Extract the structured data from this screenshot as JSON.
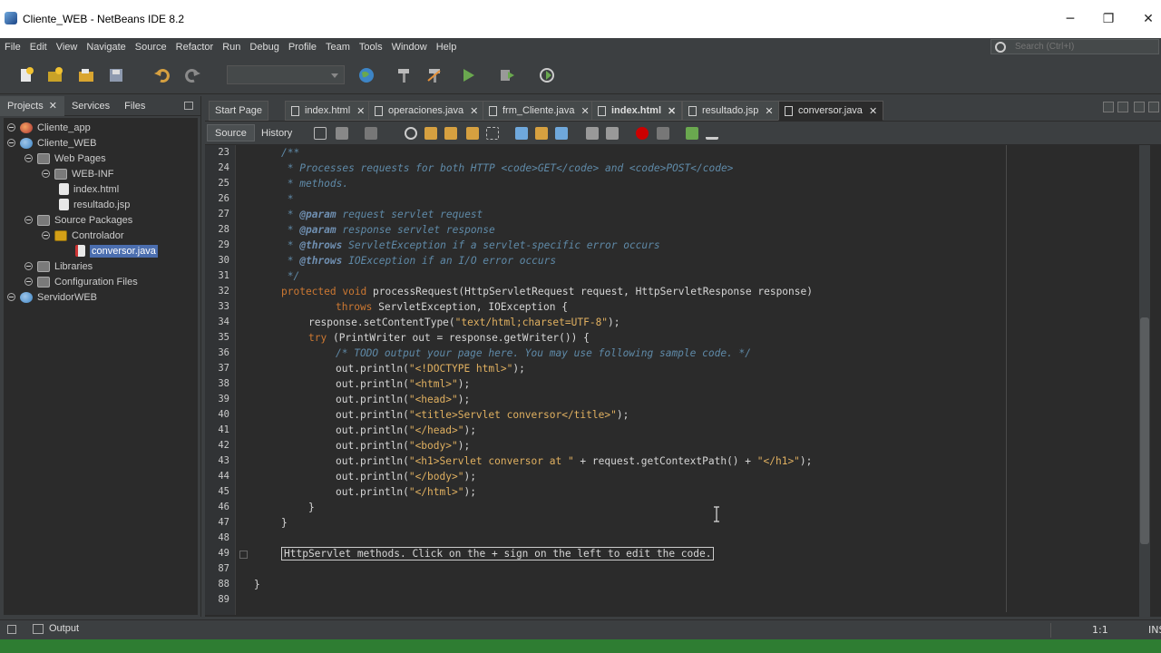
{
  "window": {
    "title": "Cliente_WEB - NetBeans IDE 8.2",
    "min": "─",
    "restore": "❐",
    "close": "✕"
  },
  "menu": [
    "File",
    "Edit",
    "View",
    "Navigate",
    "Source",
    "Refactor",
    "Run",
    "Debug",
    "Profile",
    "Team",
    "Tools",
    "Window",
    "Help"
  ],
  "search": {
    "placeholder": "Search (Ctrl+I)"
  },
  "panel_tabs": {
    "projects": "Projects",
    "services": "Services",
    "files": "Files",
    "close": "✕"
  },
  "tree": [
    {
      "label": "Cliente_app",
      "icon": "project-icon"
    },
    {
      "label": "Cliente_WEB",
      "icon": "web-project-icon"
    },
    {
      "label": "Web Pages",
      "icon": "folder-icon"
    },
    {
      "label": "WEB-INF",
      "icon": "folder-icon"
    },
    {
      "label": "index.html",
      "icon": "html-file-icon"
    },
    {
      "label": "resultado.jsp",
      "icon": "jsp-file-icon"
    },
    {
      "label": "Source Packages",
      "icon": "folder-icon"
    },
    {
      "label": "Controlador",
      "icon": "package-icon"
    },
    {
      "label": "conversor.java",
      "icon": "java-file-icon"
    },
    {
      "label": "Libraries",
      "icon": "folder-icon"
    },
    {
      "label": "Configuration Files",
      "icon": "folder-icon"
    },
    {
      "label": "ServidorWEB",
      "icon": "web-project-icon"
    }
  ],
  "editor_tabs": [
    {
      "label": "Start Page"
    },
    {
      "label": "index.html"
    },
    {
      "label": "operaciones.java"
    },
    {
      "label": "frm_Cliente.java"
    },
    {
      "label": "index.html"
    },
    {
      "label": "resultado.jsp"
    },
    {
      "label": "conversor.java"
    }
  ],
  "tab_close": "✕",
  "editor_toolbar": {
    "source": "Source",
    "history": "History"
  },
  "line_numbers": [
    "23",
    "24",
    "25",
    "26",
    "27",
    "28",
    "29",
    "30",
    "31",
    "32",
    "33",
    "34",
    "35",
    "36",
    "37",
    "38",
    "39",
    "40",
    "41",
    "42",
    "43",
    "44",
    "45",
    "46",
    "47",
    "48",
    "49",
    "87",
    "88",
    "89"
  ],
  "code": {
    "l23": "/**",
    "l24": " * Processes requests for both HTTP <code>GET</code> and <code>POST</code>",
    "l25": " * methods.",
    "l26": " *",
    "l27a": " * ",
    "l27b": "@param",
    "l27c": " request servlet request",
    "l28a": " * ",
    "l28b": "@param",
    "l28c": " response servlet response",
    "l29a": " * ",
    "l29b": "@throws",
    "l29c": " ServletException if a servlet-specific error occurs",
    "l30a": " * ",
    "l30b": "@throws",
    "l30c": " IOException if an I/O error occurs",
    "l31": " */",
    "l32a": "protected void",
    "l32b": " processRequest(HttpServletRequest request, HttpServletResponse response)",
    "l33a": "throws",
    "l33b": " ServletException, IOException {",
    "l34a": "response.setContentType(",
    "l34b": "\"text/html;charset=UTF-8\"",
    "l34c": ");",
    "l35a": "try",
    "l35b": " (PrintWriter out = response.getWriter()) {",
    "l36": "/* TODO output your page here. You may use following sample code. */",
    "l37a": "out.println(",
    "l37b": "\"<!DOCTYPE html>\"",
    "l37c": ");",
    "l38a": "out.println(",
    "l38b": "\"<html>\"",
    "l38c": ");",
    "l39a": "out.println(",
    "l39b": "\"<head>\"",
    "l39c": ");",
    "l40a": "out.println(",
    "l40b": "\"<title>Servlet conversor</title>\"",
    "l40c": ");",
    "l41a": "out.println(",
    "l41b": "\"</head>\"",
    "l41c": ");",
    "l42a": "out.println(",
    "l42b": "\"<body>\"",
    "l42c": ");",
    "l43a": "out.println(",
    "l43b": "\"<h1>Servlet conversor at \"",
    "l43c": " + request.getContextPath() + ",
    "l43d": "\"</h1>\"",
    "l43e": ");",
    "l44a": "out.println(",
    "l44b": "\"</body>\"",
    "l44c": ");",
    "l45a": "out.println(",
    "l45b": "\"</html>\"",
    "l45c": ");",
    "l46": "}",
    "l47": "}",
    "l49": "HttpServlet methods. Click on the + sign on the left to edit the code.",
    "l88": "}"
  },
  "status": {
    "output": "Output",
    "position": "1:1",
    "mode": "INS"
  },
  "colors": {
    "keyword": "#cc7832",
    "string": "#e0b060",
    "comment": "#5f8aa8",
    "status_green": "#2e7d32"
  }
}
